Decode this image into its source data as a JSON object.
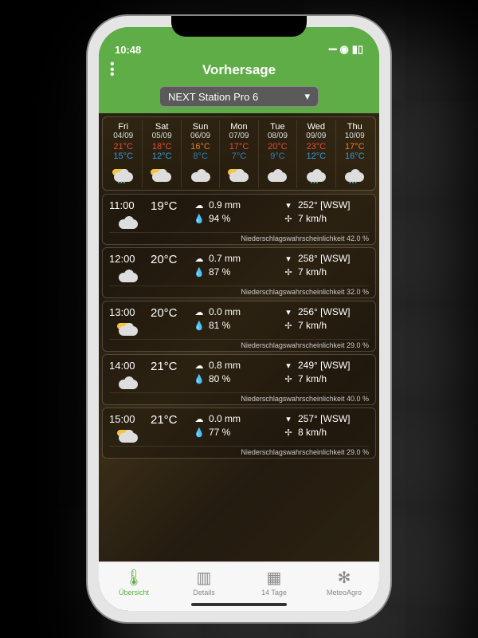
{
  "status": {
    "time": "10:48"
  },
  "header": {
    "title": "Vorhersage"
  },
  "station": {
    "selected": "NEXT Station Pro 6"
  },
  "week": [
    {
      "name": "Fri",
      "date": "04/09",
      "hi": "21°C",
      "hi_color": "#e74c3c",
      "lo": "15°C",
      "lo_color": "#3498db",
      "icon": "sun-cloud-rain"
    },
    {
      "name": "Sat",
      "date": "05/09",
      "hi": "18°C",
      "hi_color": "#e74c3c",
      "lo": "12°C",
      "lo_color": "#3498db",
      "icon": "sun-cloud"
    },
    {
      "name": "Sun",
      "date": "06/09",
      "hi": "16°C",
      "hi_color": "#e67e22",
      "lo": "8°C",
      "lo_color": "#2980b9",
      "icon": "cloud"
    },
    {
      "name": "Mon",
      "date": "07/09",
      "hi": "17°C",
      "hi_color": "#e74c3c",
      "lo": "7°C",
      "lo_color": "#2980b9",
      "icon": "sun-cloud"
    },
    {
      "name": "Tue",
      "date": "08/09",
      "hi": "20°C",
      "hi_color": "#e74c3c",
      "lo": "9°C",
      "lo_color": "#2980b9",
      "icon": "cloud"
    },
    {
      "name": "Wed",
      "date": "09/09",
      "hi": "23°C",
      "hi_color": "#e74c3c",
      "lo": "12°C",
      "lo_color": "#3498db",
      "icon": "cloud-rain"
    },
    {
      "name": "Thu",
      "date": "10/09",
      "hi": "17°C",
      "hi_color": "#e67e22",
      "lo": "16°C",
      "lo_color": "#3498db",
      "icon": "cloud-rain"
    }
  ],
  "hours": [
    {
      "time": "11:00",
      "temp": "19°C",
      "icon": "cloud",
      "precip": "0.9 mm",
      "humidity": "94 %",
      "wind_dir": "252° [WSW]",
      "wind_spd": "7 km/h",
      "prob_label": "Niederschlagswahrscheinlichkeit",
      "prob": "42.0 %"
    },
    {
      "time": "12:00",
      "temp": "20°C",
      "icon": "cloud",
      "precip": "0.7 mm",
      "humidity": "87 %",
      "wind_dir": "258° [WSW]",
      "wind_spd": "7 km/h",
      "prob_label": "Niederschlagswahrscheinlichkeit",
      "prob": "32.0 %"
    },
    {
      "time": "13:00",
      "temp": "20°C",
      "icon": "sun-cloud",
      "precip": "0.0 mm",
      "humidity": "81 %",
      "wind_dir": "256° [WSW]",
      "wind_spd": "7 km/h",
      "prob_label": "Niederschlagswahrscheinlichkeit",
      "prob": "29.0 %"
    },
    {
      "time": "14:00",
      "temp": "21°C",
      "icon": "cloud",
      "precip": "0.8 mm",
      "humidity": "80 %",
      "wind_dir": "249° [WSW]",
      "wind_spd": "7 km/h",
      "prob_label": "Niederschlagswahrscheinlichkeit",
      "prob": "40.0 %"
    },
    {
      "time": "15:00",
      "temp": "21°C",
      "icon": "sun-cloud",
      "precip": "0.0 mm",
      "humidity": "77 %",
      "wind_dir": "257° [WSW]",
      "wind_spd": "8 km/h",
      "prob_label": "Niederschlagswahrscheinlichkeit",
      "prob": "29.0 %"
    }
  ],
  "tabs": [
    {
      "label": "Übersicht",
      "icon": "thermometer",
      "active": true
    },
    {
      "label": "Details",
      "icon": "bars",
      "active": false
    },
    {
      "label": "14 Tage",
      "icon": "calendar",
      "active": false
    },
    {
      "label": "MeteoAgro",
      "icon": "gear",
      "active": false
    }
  ]
}
